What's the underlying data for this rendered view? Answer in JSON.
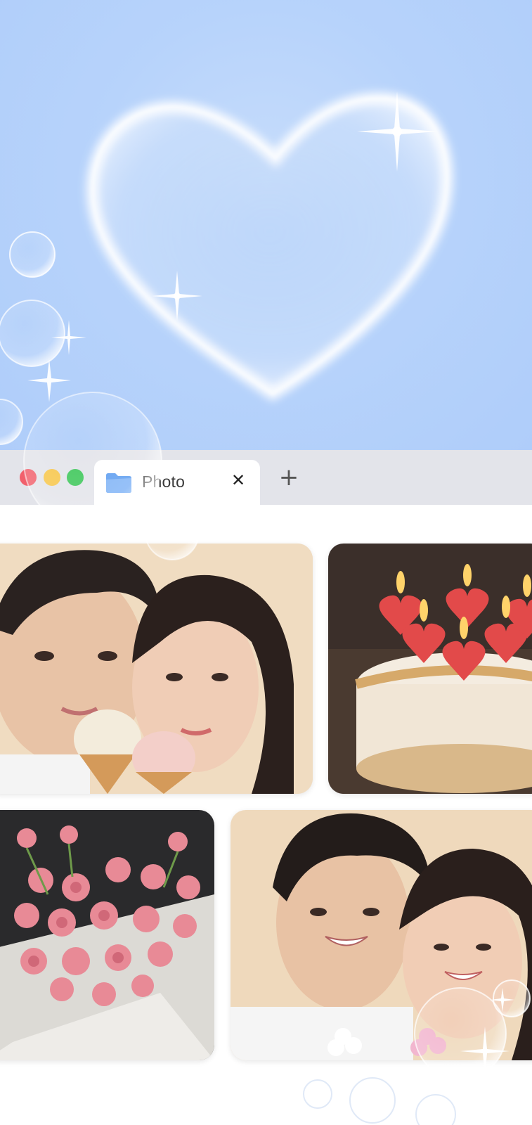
{
  "window": {
    "controls": {
      "close_color": "#f1606c",
      "minimize_color": "#f7c64a",
      "maximize_color": "#3ec75a"
    },
    "tabs": [
      {
        "label": "Photo",
        "icon": "folder-icon",
        "close_glyph": "✕"
      }
    ],
    "new_tab_glyph": "+"
  },
  "hero": {
    "background_color": "#b7d3fb",
    "decorations": [
      "heart-bubble-icon",
      "sparkle-icon",
      "bubble-icon"
    ]
  },
  "gallery": {
    "photos": [
      {
        "subject": "couple-with-ice-cream"
      },
      {
        "subject": "birthday-cake-with-heart-candles"
      },
      {
        "subject": "pink-rose-bouquet"
      },
      {
        "subject": "smiling-couple-with-flowers"
      }
    ]
  }
}
